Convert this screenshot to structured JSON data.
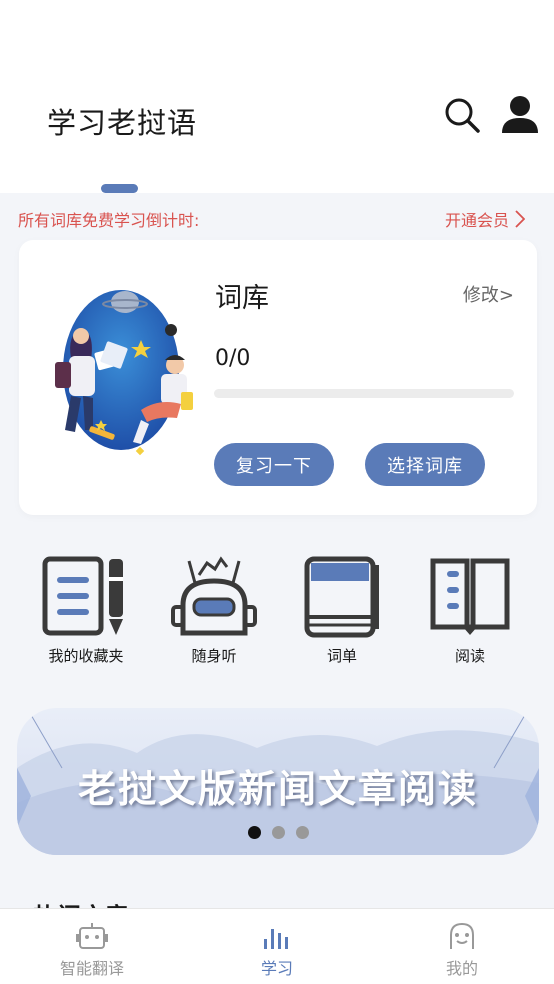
{
  "header": {
    "title": "学习老挝语"
  },
  "promo": {
    "text": "所有词库免费学习倒计时:",
    "vip_label": "开通会员"
  },
  "library_card": {
    "title": "词库",
    "edit_label": "修改>",
    "progress_text": "0/0",
    "progress_fraction": 0,
    "review_button": "复习一下",
    "select_button": "选择词库"
  },
  "features": [
    {
      "label": "我的收藏夹",
      "icon": "notebook-pen-icon"
    },
    {
      "label": "随身听",
      "icon": "radio-robot-icon"
    },
    {
      "label": "词单",
      "icon": "book-icon"
    },
    {
      "label": "阅读",
      "icon": "open-book-icon"
    }
  ],
  "banner": {
    "text": "老挝文版新闻文章阅读",
    "active_dot": 0,
    "dot_count": 3
  },
  "section_peek": "热门文章",
  "tabbar": {
    "items": [
      {
        "label": "智能翻译",
        "icon": "robot-icon"
      },
      {
        "label": "学习",
        "icon": "bar-chart-icon"
      },
      {
        "label": "我的",
        "icon": "face-icon"
      }
    ],
    "active_index": 1
  },
  "colors": {
    "accent": "#5a7bb8",
    "promo": "#d9534f",
    "background": "#f3f5f9"
  }
}
